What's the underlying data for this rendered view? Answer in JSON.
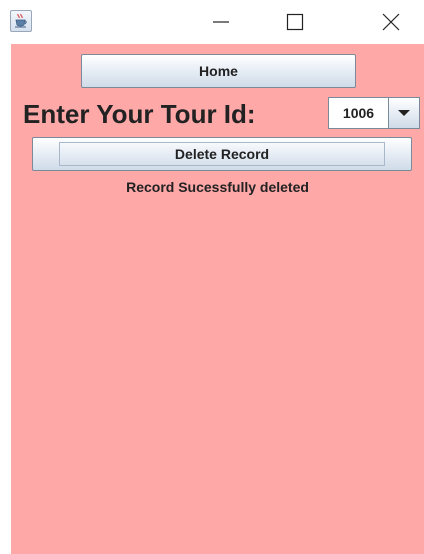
{
  "window": {
    "controls": {
      "minimize_icon": "minimize-icon",
      "maximize_icon": "maximize-icon",
      "close_icon": "close-icon"
    },
    "app_icon": "java-coffee-cup-icon"
  },
  "colors": {
    "content_background": "#ffa8a8",
    "text": "#222222",
    "button_border": "#7a8a99"
  },
  "form": {
    "home_label": "Home",
    "prompt_label": "Enter Your Tour Id:",
    "tour_id_selected": "1006",
    "delete_label": "Delete Record",
    "status_message": "Record Sucessfully deleted"
  }
}
